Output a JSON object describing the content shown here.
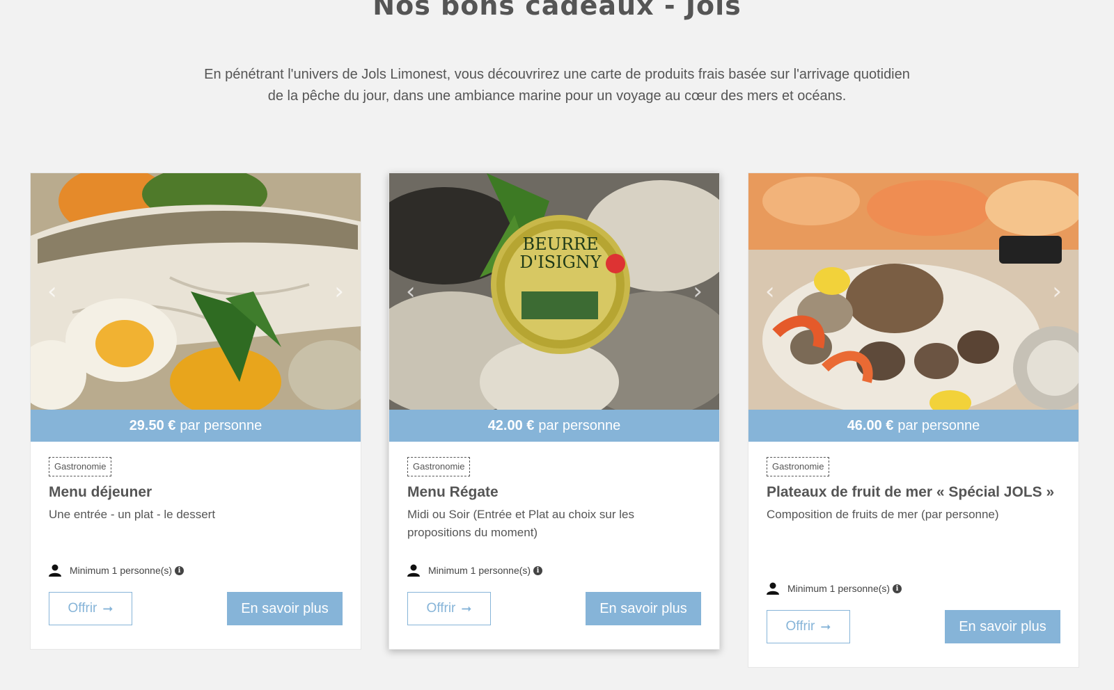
{
  "page": {
    "title": "Nos bons cadeaux - Jols",
    "intro": "En pénétrant l'univers de Jols Limonest, vous découvrirez une carte de produits frais basée sur l'arrivage quotidien de la pêche du jour, dans une ambiance marine pour un voyage au cœur des mers et océans."
  },
  "colors": {
    "accent": "#86b4d8",
    "background": "#f2f2f2"
  },
  "cards": [
    {
      "price": "29.50 €",
      "price_suffix": "par personne",
      "category": "Gastronomie",
      "title": "Menu déjeuner",
      "description": "Une entrée - un plat - le dessert",
      "minimum": "Minimum 1 personne(s)",
      "offer_label": "Offrir",
      "more_label": "En savoir plus"
    },
    {
      "price": "42.00 €",
      "price_suffix": "par personne",
      "category": "Gastronomie",
      "title": "Menu Régate",
      "description": "Midi ou Soir (Entrée et Plat au choix sur les propositions du moment)",
      "minimum": "Minimum 1 personne(s)",
      "offer_label": "Offrir",
      "more_label": "En savoir plus"
    },
    {
      "price": "46.00 €",
      "price_suffix": "par personne",
      "category": "Gastronomie",
      "title": "Plateaux de fruit de mer « Spécial JOLS »",
      "description": "Composition de fruits de mer (par personne)",
      "minimum": "Minimum 1 personne(s)",
      "offer_label": "Offrir",
      "more_label": "En savoir plus"
    }
  ],
  "icons": {
    "person": "person-icon",
    "info": "info-icon",
    "arrow": "arrow-right-icon",
    "prev": "chevron-left-icon",
    "next": "chevron-right-icon"
  }
}
